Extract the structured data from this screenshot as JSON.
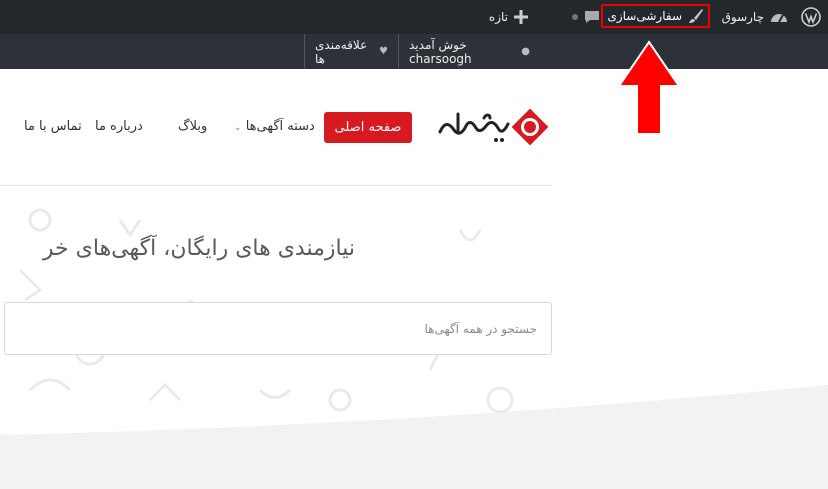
{
  "admin_bar": {
    "site_name": "چارسوق",
    "customize_label": "سفارشی‌سازی",
    "new_label": "تازه",
    "icons": {
      "wp": "wordpress-icon",
      "dashboard": "dashboard-icon",
      "brush": "brush-icon",
      "comments": "comment-icon",
      "plus": "plus-icon"
    }
  },
  "user_bar": {
    "welcome": "خوش آمدید charsoogh",
    "favorites": "علاقه‌مندی ها"
  },
  "nav": {
    "home": "صفحه اصلی",
    "categories": "دسته آگهی‌ها",
    "blog": "وبلاگ",
    "about": "درباره ما",
    "contact": "تماس با ما"
  },
  "hero": {
    "title": "نیازمندی های رایگان، آگهی‌های خر"
  },
  "search": {
    "placeholder": "جستجو در همه آگهی‌ها"
  },
  "colors": {
    "admin_bg": "#23282d",
    "accent": "#d71921",
    "highlight": "#ee0000"
  }
}
